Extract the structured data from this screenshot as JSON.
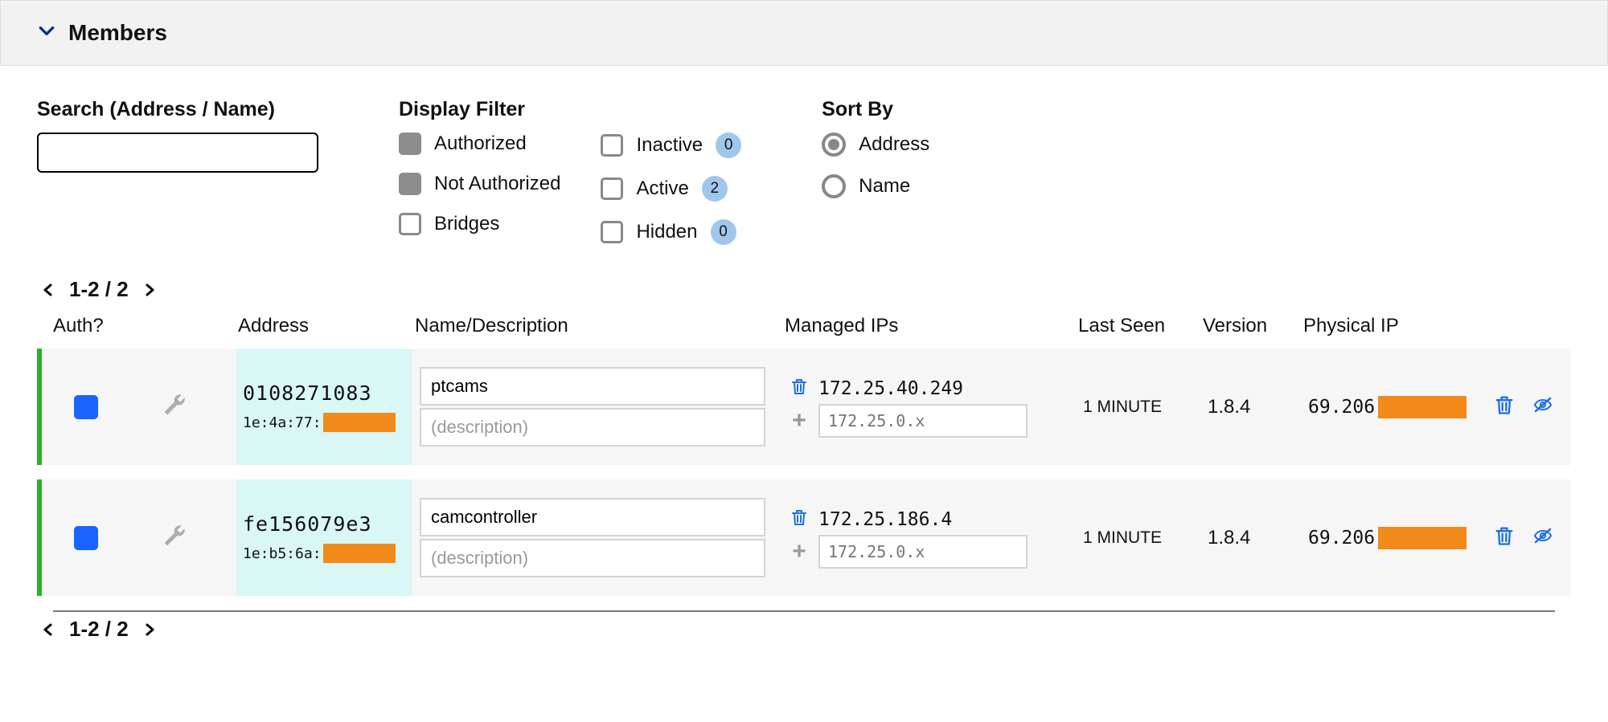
{
  "panel": {
    "title": "Members"
  },
  "search": {
    "label": "Search (Address / Name)",
    "value": ""
  },
  "display_filter": {
    "label": "Display Filter",
    "items": [
      {
        "key": "authorized",
        "label": "Authorized",
        "checked": true
      },
      {
        "key": "not-authorized",
        "label": "Not Authorized",
        "checked": true
      },
      {
        "key": "bridges",
        "label": "Bridges",
        "checked": false
      }
    ],
    "status_items": [
      {
        "key": "inactive",
        "label": "Inactive",
        "checked": false,
        "count": 0
      },
      {
        "key": "active",
        "label": "Active",
        "checked": false,
        "count": 2
      },
      {
        "key": "hidden",
        "label": "Hidden",
        "checked": false,
        "count": 0
      }
    ]
  },
  "sort": {
    "label": "Sort By",
    "options": [
      {
        "key": "address",
        "label": "Address",
        "selected": true
      },
      {
        "key": "name",
        "label": "Name",
        "selected": false
      }
    ]
  },
  "pager": {
    "range": "1-2 / 2"
  },
  "columns": {
    "auth": "Auth?",
    "address": "Address",
    "name": "Name/Description",
    "managed_ips": "Managed IPs",
    "last_seen": "Last Seen",
    "version": "Version",
    "physical_ip": "Physical IP"
  },
  "rows": [
    {
      "authorized": true,
      "address": "0108271083",
      "mac_prefix": "1e:4a:77:",
      "name": "ptcams",
      "description_placeholder": "(description)",
      "managed_ip": "172.25.40.249",
      "add_ip_placeholder": "172.25.0.x",
      "last_seen": "1 MINUTE",
      "version": "1.8.4",
      "physical_ip_prefix": "69.206"
    },
    {
      "authorized": true,
      "address": "fe156079e3",
      "mac_prefix": "1e:b5:6a:",
      "name": "camcontroller",
      "description_placeholder": "(description)",
      "managed_ip": "172.25.186.4",
      "add_ip_placeholder": "172.25.0.x",
      "last_seen": "1 MINUTE",
      "version": "1.8.4",
      "physical_ip_prefix": "69.206"
    }
  ]
}
